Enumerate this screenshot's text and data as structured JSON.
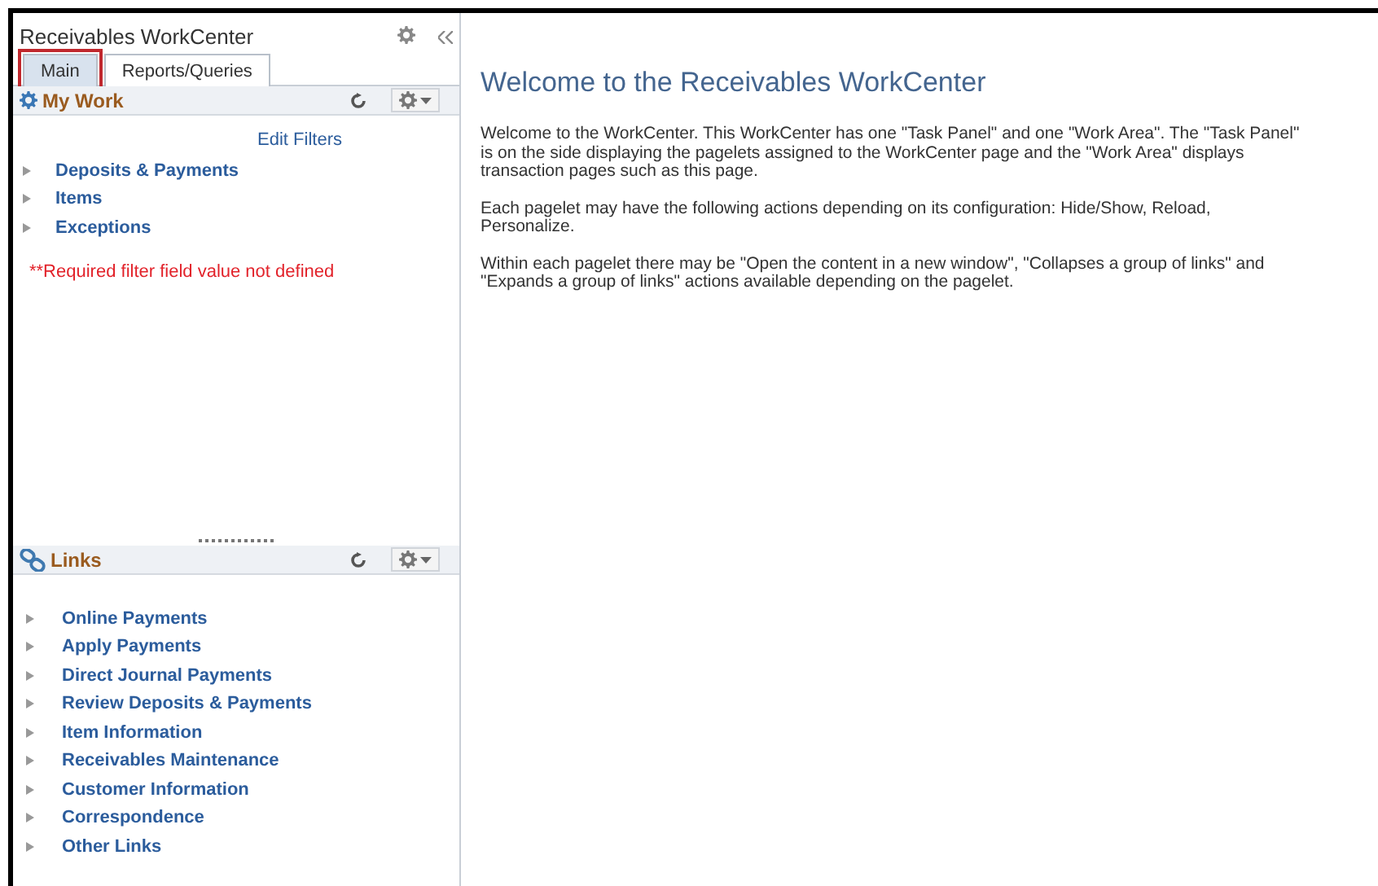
{
  "panel": {
    "title": "Receivables WorkCenter"
  },
  "tabs": [
    {
      "label": "Main",
      "selected": true,
      "highlighted": true
    },
    {
      "label": "Reports/Queries",
      "selected": false,
      "highlighted": false
    }
  ],
  "pagelets": [
    {
      "title": "My Work",
      "action": "Edit Filters",
      "items": [
        {
          "label": "Deposits & Payments",
          "expanded": false
        },
        {
          "label": "Items",
          "expanded": false
        },
        {
          "label": "Exceptions",
          "expanded": false
        }
      ],
      "message": "**Required filter field value not defined"
    },
    {
      "title": "Links",
      "items": [
        {
          "label": "Online Payments",
          "expanded": false
        },
        {
          "label": "Apply Payments",
          "expanded": false
        },
        {
          "label": "Direct Journal Payments",
          "expanded": false
        },
        {
          "label": "Review Deposits & Payments",
          "expanded": false
        },
        {
          "label": "Item Information",
          "expanded": false
        },
        {
          "label": "Receivables Maintenance",
          "expanded": false
        },
        {
          "label": "Customer Information",
          "expanded": false
        },
        {
          "label": "Correspondence",
          "expanded": false
        },
        {
          "label": "Other Links",
          "expanded": false
        }
      ]
    }
  ],
  "main": {
    "title": "Welcome to the Receivables WorkCenter",
    "paragraphs": [
      "Welcome to the WorkCenter. This WorkCenter has one \"Task Panel\" and one \"Work Area\". The \"Task Panel\" is on the side displaying the pagelets assigned to the WorkCenter page and the \"Work Area\" displays transaction pages such as this page.",
      "Each pagelet may have the following actions depending on its configuration: Hide/Show, Reload, Personalize.",
      "Within each pagelet there may be \"Open the content in a new window\", \"Collapses a group of links\" and \"Expands a group of links\" actions available depending on the pagelet."
    ]
  }
}
